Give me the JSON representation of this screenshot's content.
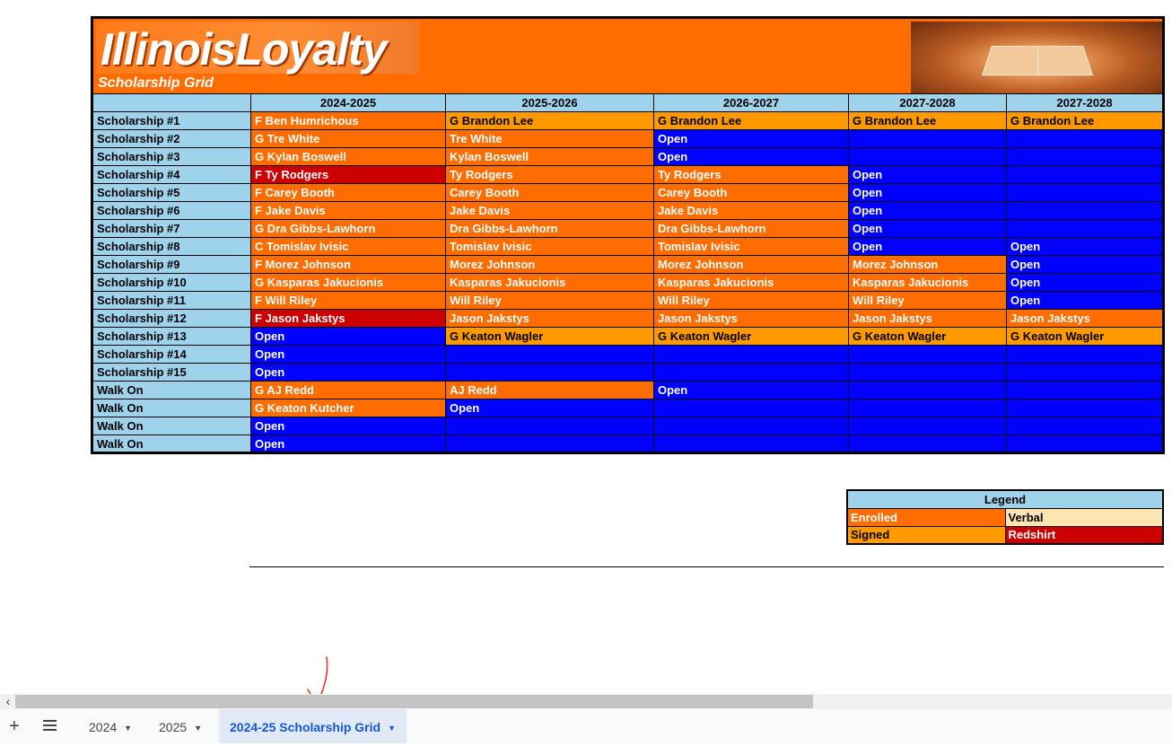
{
  "header": {
    "logo_text": "IllinoisLoyalty",
    "subtitle": "Scholarship Grid"
  },
  "grid": {
    "columns": [
      "2024-2025",
      "2025-2026",
      "2026-2027",
      "2027-2028",
      "2027-2028"
    ],
    "rows": [
      {
        "label": "Scholarship #1",
        "cells": [
          {
            "t": "F Ben Humrichous",
            "s": "enrolled"
          },
          {
            "t": "G Brandon Lee",
            "s": "signed"
          },
          {
            "t": "G Brandon Lee",
            "s": "signed"
          },
          {
            "t": "G Brandon Lee",
            "s": "signed"
          },
          {
            "t": "G Brandon Lee",
            "s": "signed"
          }
        ]
      },
      {
        "label": "Scholarship #2",
        "cells": [
          {
            "t": "G Tre White",
            "s": "enrolled"
          },
          {
            "t": "Tre White",
            "s": "enrolled"
          },
          {
            "t": "Open",
            "s": "open"
          },
          {
            "t": "",
            "s": "open"
          },
          {
            "t": "",
            "s": "open"
          }
        ]
      },
      {
        "label": "Scholarship #3",
        "cells": [
          {
            "t": "G Kylan Boswell",
            "s": "enrolled"
          },
          {
            "t": "Kylan Boswell",
            "s": "enrolled"
          },
          {
            "t": "Open",
            "s": "open"
          },
          {
            "t": "",
            "s": "open"
          },
          {
            "t": "",
            "s": "open"
          }
        ]
      },
      {
        "label": "Scholarship #4",
        "cells": [
          {
            "t": "F Ty Rodgers",
            "s": "redshirt"
          },
          {
            "t": "Ty Rodgers",
            "s": "enrolled"
          },
          {
            "t": "Ty Rodgers",
            "s": "enrolled"
          },
          {
            "t": "Open",
            "s": "open"
          },
          {
            "t": "",
            "s": "open"
          }
        ]
      },
      {
        "label": "Scholarship #5",
        "cells": [
          {
            "t": "F Carey Booth",
            "s": "enrolled"
          },
          {
            "t": "Carey Booth",
            "s": "enrolled"
          },
          {
            "t": "Carey Booth",
            "s": "enrolled"
          },
          {
            "t": "Open",
            "s": "open"
          },
          {
            "t": "",
            "s": "open"
          }
        ]
      },
      {
        "label": "Scholarship #6",
        "cells": [
          {
            "t": "F Jake Davis",
            "s": "enrolled"
          },
          {
            "t": "Jake Davis",
            "s": "enrolled"
          },
          {
            "t": "Jake Davis",
            "s": "enrolled"
          },
          {
            "t": "Open",
            "s": "open"
          },
          {
            "t": "",
            "s": "open"
          }
        ]
      },
      {
        "label": "Scholarship #7",
        "cells": [
          {
            "t": "G Dra Gibbs-Lawhorn",
            "s": "enrolled"
          },
          {
            "t": "Dra Gibbs-Lawhorn",
            "s": "enrolled"
          },
          {
            "t": "Dra Gibbs-Lawhorn",
            "s": "enrolled"
          },
          {
            "t": "Open",
            "s": "open"
          },
          {
            "t": "",
            "s": "open"
          }
        ]
      },
      {
        "label": "Scholarship #8",
        "cells": [
          {
            "t": "C Tomislav Ivisic",
            "s": "enrolled"
          },
          {
            "t": "Tomislav Ivisic",
            "s": "enrolled"
          },
          {
            "t": "Tomislav Ivisic",
            "s": "enrolled"
          },
          {
            "t": "Open",
            "s": "open"
          },
          {
            "t": "Open",
            "s": "open"
          }
        ]
      },
      {
        "label": "Scholarship #9",
        "cells": [
          {
            "t": "F Morez Johnson",
            "s": "enrolled"
          },
          {
            "t": "Morez Johnson",
            "s": "enrolled"
          },
          {
            "t": "Morez Johnson",
            "s": "enrolled"
          },
          {
            "t": "Morez Johnson",
            "s": "enrolled"
          },
          {
            "t": "Open",
            "s": "open"
          }
        ]
      },
      {
        "label": "Scholarship #10",
        "cells": [
          {
            "t": "G Kasparas Jakucionis",
            "s": "enrolled"
          },
          {
            "t": "Kasparas Jakucionis",
            "s": "enrolled"
          },
          {
            "t": "Kasparas Jakucionis",
            "s": "enrolled"
          },
          {
            "t": "Kasparas Jakucionis",
            "s": "enrolled"
          },
          {
            "t": "Open",
            "s": "open"
          }
        ]
      },
      {
        "label": "Scholarship #11",
        "cells": [
          {
            "t": "F Will Riley",
            "s": "enrolled"
          },
          {
            "t": "Will Riley",
            "s": "enrolled"
          },
          {
            "t": "Will Riley",
            "s": "enrolled"
          },
          {
            "t": "Will Riley",
            "s": "enrolled"
          },
          {
            "t": "Open",
            "s": "open"
          }
        ]
      },
      {
        "label": "Scholarship #12",
        "cells": [
          {
            "t": "F Jason Jakstys",
            "s": "redshirt"
          },
          {
            "t": "Jason Jakstys",
            "s": "enrolled"
          },
          {
            "t": "Jason Jakstys",
            "s": "enrolled"
          },
          {
            "t": "Jason Jakstys",
            "s": "enrolled"
          },
          {
            "t": "Jason Jakstys",
            "s": "enrolled"
          }
        ]
      },
      {
        "label": "Scholarship #13",
        "cells": [
          {
            "t": "Open",
            "s": "open"
          },
          {
            "t": "G Keaton Wagler",
            "s": "signed"
          },
          {
            "t": "G Keaton Wagler",
            "s": "signed"
          },
          {
            "t": "G Keaton Wagler",
            "s": "signed"
          },
          {
            "t": "G Keaton Wagler",
            "s": "signed"
          }
        ]
      },
      {
        "label": "Scholarship #14",
        "cells": [
          {
            "t": "Open",
            "s": "open"
          },
          {
            "t": "",
            "s": "open"
          },
          {
            "t": "",
            "s": "open"
          },
          {
            "t": "",
            "s": "open"
          },
          {
            "t": "",
            "s": "open"
          }
        ]
      },
      {
        "label": "Scholarship #15",
        "cells": [
          {
            "t": "Open",
            "s": "open"
          },
          {
            "t": "",
            "s": "open"
          },
          {
            "t": "",
            "s": "open"
          },
          {
            "t": "",
            "s": "open"
          },
          {
            "t": "",
            "s": "open"
          }
        ]
      },
      {
        "label": "Walk On",
        "cells": [
          {
            "t": "G AJ Redd",
            "s": "enrolled"
          },
          {
            "t": "AJ Redd",
            "s": "enrolled"
          },
          {
            "t": "Open",
            "s": "open"
          },
          {
            "t": "",
            "s": "open"
          },
          {
            "t": "",
            "s": "open"
          }
        ]
      },
      {
        "label": "Walk On",
        "cells": [
          {
            "t": "G Keaton Kutcher",
            "s": "enrolled"
          },
          {
            "t": "Open",
            "s": "open"
          },
          {
            "t": "",
            "s": "open"
          },
          {
            "t": "",
            "s": "open"
          },
          {
            "t": "",
            "s": "open"
          }
        ]
      },
      {
        "label": "Walk On",
        "cells": [
          {
            "t": "Open",
            "s": "open"
          },
          {
            "t": "",
            "s": "open"
          },
          {
            "t": "",
            "s": "open"
          },
          {
            "t": "",
            "s": "open"
          },
          {
            "t": "",
            "s": "open"
          }
        ]
      },
      {
        "label": "Walk On",
        "cells": [
          {
            "t": "Open",
            "s": "open"
          },
          {
            "t": "",
            "s": "open"
          },
          {
            "t": "",
            "s": "open"
          },
          {
            "t": "",
            "s": "open"
          },
          {
            "t": "",
            "s": "open"
          }
        ]
      }
    ]
  },
  "legend": {
    "title": "Legend",
    "items": [
      {
        "label": "Enrolled",
        "s": "enrolled"
      },
      {
        "label": "Verbal",
        "s": "verbal"
      },
      {
        "label": "Signed",
        "s": "signed"
      },
      {
        "label": "Redshirt",
        "s": "redshirt"
      }
    ]
  },
  "colors": {
    "enrolled": "#ff6d00",
    "signed": "#ff9900",
    "redshirt": "#cc0000",
    "open": "#0000ff",
    "verbal": "#fce5b1",
    "header": "#9fd3ec",
    "annotation": "#e53935",
    "active_tab_text": "#1558d6"
  },
  "icons": {
    "add": "plus-icon",
    "all_sheets": "menu-icon",
    "tab_menu": "caret-down-icon",
    "scroll_left": "chevron-left-icon"
  },
  "tabs": [
    {
      "label": "2024",
      "active": false
    },
    {
      "label": "2025",
      "active": false
    },
    {
      "label": "2024-25 Scholarship Grid",
      "active": true
    }
  ],
  "glyphs": {
    "add": "+",
    "scroll_left": "‹",
    "caret": "▼"
  }
}
